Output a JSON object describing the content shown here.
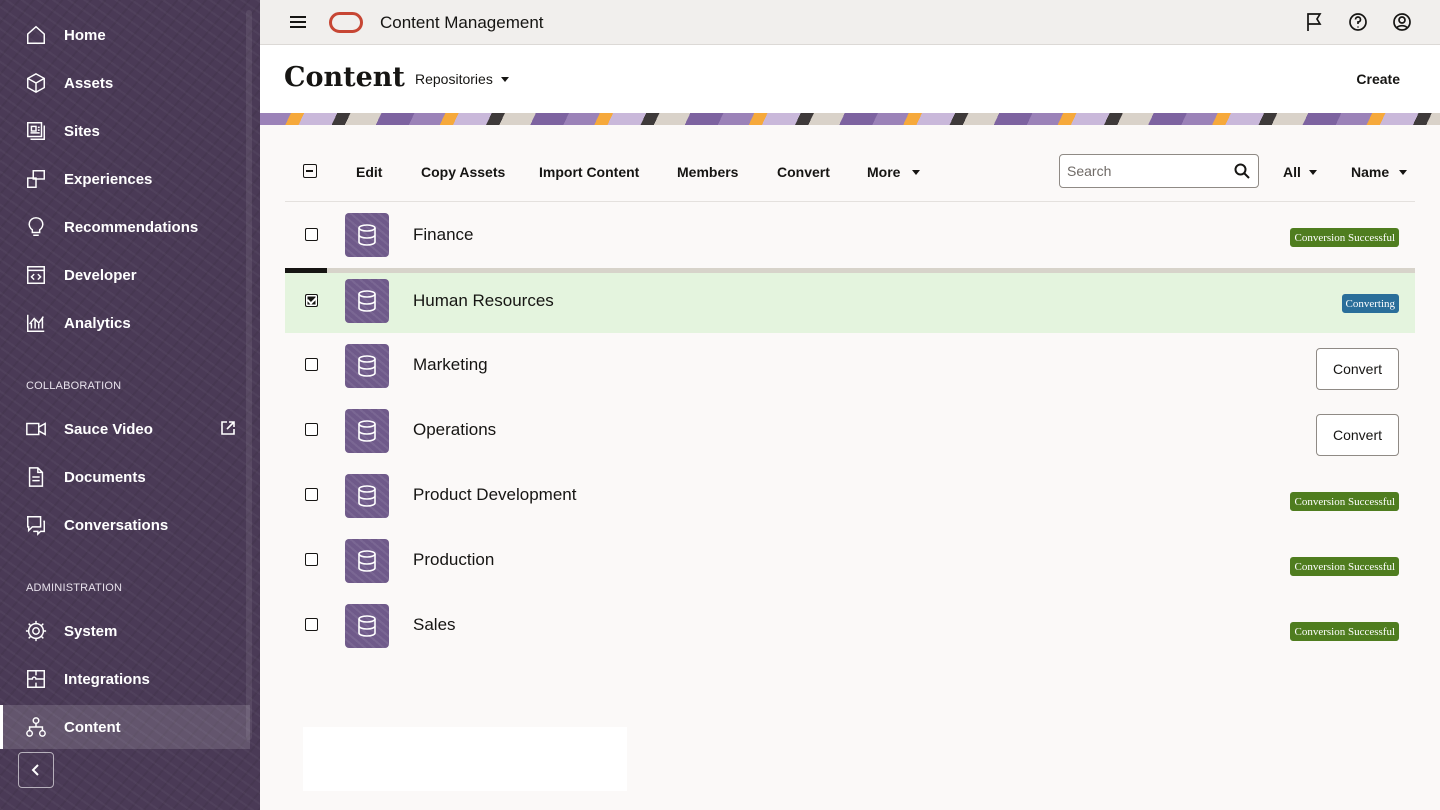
{
  "app": {
    "title": "Content Management"
  },
  "sidebar": {
    "items": [
      {
        "label": "Home",
        "icon": "home-icon"
      },
      {
        "label": "Assets",
        "icon": "cube-icon"
      },
      {
        "label": "Sites",
        "icon": "sites-icon"
      },
      {
        "label": "Experiences",
        "icon": "experiences-icon"
      },
      {
        "label": "Recommendations",
        "icon": "lightbulb-icon"
      },
      {
        "label": "Developer",
        "icon": "code-icon"
      },
      {
        "label": "Analytics",
        "icon": "analytics-icon"
      }
    ],
    "collaboration_header": "COLLABORATION",
    "collaboration": [
      {
        "label": "Sauce Video",
        "icon": "video-icon"
      },
      {
        "label": "Documents",
        "icon": "documents-icon"
      },
      {
        "label": "Conversations",
        "icon": "conversations-icon"
      }
    ],
    "administration_header": "ADMINISTRATION",
    "administration": [
      {
        "label": "System",
        "icon": "gear-icon"
      },
      {
        "label": "Integrations",
        "icon": "integrations-icon"
      },
      {
        "label": "Content",
        "icon": "hierarchy-icon"
      }
    ]
  },
  "header": {
    "page_title": "Content",
    "repositories_label": "Repositories",
    "create_label": "Create"
  },
  "toolbar": {
    "edit": "Edit",
    "copy_assets": "Copy Assets",
    "import_content": "Import Content",
    "members": "Members",
    "convert": "Convert",
    "more": "More",
    "search_placeholder": "Search",
    "filter": "All",
    "sort": "Name"
  },
  "repositories": [
    {
      "name": "Finance",
      "status": "Conversion Successful"
    },
    {
      "name": "Human Resources",
      "status": "Converting",
      "selected": true
    },
    {
      "name": "Marketing",
      "action": "Convert"
    },
    {
      "name": "Operations",
      "action": "Convert"
    },
    {
      "name": "Product Development",
      "status": "Conversion Successful"
    },
    {
      "name": "Production",
      "status": "Conversion Successful"
    },
    {
      "name": "Sales",
      "status": "Conversion Successful"
    }
  ],
  "colors": {
    "sidebar": "#4a3a56",
    "success": "#4f7d1f",
    "converting": "#2a6e9a",
    "selected_row": "#e4f4de",
    "brand": "#c74634"
  }
}
